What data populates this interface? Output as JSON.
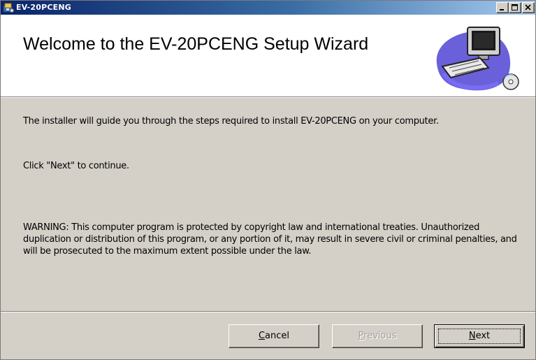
{
  "window": {
    "title": "EV-20PCENG",
    "controls": [
      "minimize",
      "maximize",
      "close"
    ]
  },
  "header": {
    "title": "Welcome to the EV-20PCENG Setup Wizard",
    "logo_icon": "computer-install-icon"
  },
  "body": {
    "intro": "The installer will guide you through the steps required to install EV-20PCENG on your computer.",
    "continue_hint": "Click \"Next\" to continue.",
    "warning": "WARNING: This computer program is protected by copyright law and international treaties. Unauthorized duplication or distribution of this program, or any portion of it, may result in severe civil or criminal penalties, and will be prosecuted to the maximum extent possible under the law."
  },
  "buttons": {
    "cancel": {
      "mnemonic": "C",
      "rest": "ancel",
      "enabled": true
    },
    "previous": {
      "mnemonic": "P",
      "rest": "revious",
      "enabled": false
    },
    "next": {
      "mnemonic": "N",
      "rest": "ext",
      "enabled": true,
      "default": true
    }
  },
  "colors": {
    "face": "#d4d0c8",
    "title_start": "#0a246a",
    "title_end": "#a6caf0",
    "disabled_text": "#a0a0a0"
  }
}
